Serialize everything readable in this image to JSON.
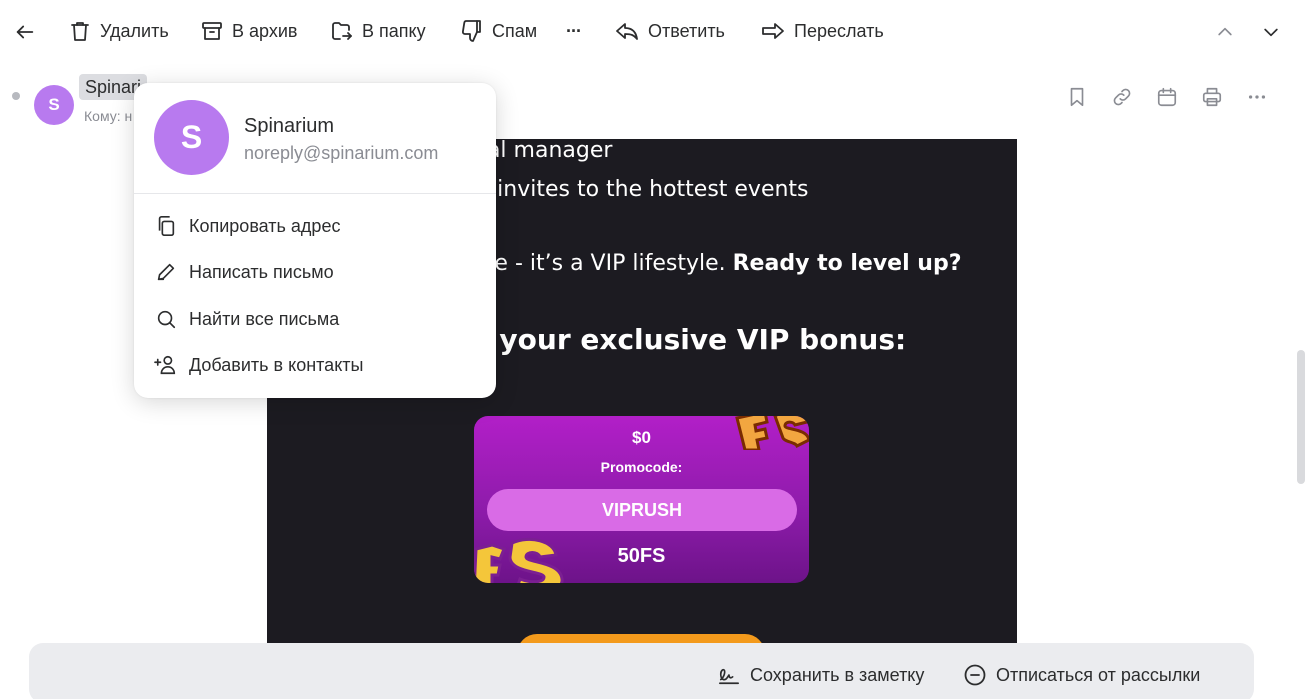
{
  "toolbar": {
    "back_icon": "arrow-left-icon",
    "delete_label": "Удалить",
    "archive_label": "В архив",
    "folder_label": "В папку",
    "spam_label": "Спам",
    "more_label": "···",
    "reply_label": "Ответить",
    "forward_label": "Переслать",
    "prev_icon": "chevron-up-icon",
    "next_icon": "chevron-down-icon"
  },
  "message": {
    "sender_chip": "Spinari",
    "avatar_letter": "S",
    "to_prefix": "Кому: н"
  },
  "header_icons": [
    "bookmark-icon",
    "link-icon",
    "calendar-icon",
    "print-icon",
    "more-icon"
  ],
  "email_body": {
    "line1": "nal manager",
    "line2": "& invites to the hottest events",
    "line3_plain": "me - it’s a VIP lifestyle. ",
    "line3_bold": "Ready to level up?",
    "heading": "s your exclusive VIP bonus:",
    "promo": {
      "amount": "$0",
      "label": "Promocode:",
      "code": "VIPRUSH",
      "freespins": "50FS"
    }
  },
  "popup": {
    "avatar_letter": "S",
    "name": "Spinarium",
    "email": "noreply@spinarium.com",
    "items": [
      {
        "label": "Копировать адрес",
        "icon": "copy-icon"
      },
      {
        "label": "Написать письмо",
        "icon": "pencil-icon"
      },
      {
        "label": "Найти все письма",
        "icon": "search-icon"
      },
      {
        "label": "Добавить в контакты",
        "icon": "add-contact-icon"
      }
    ]
  },
  "bottom_bar": {
    "save_note_label": "Сохранить в заметку",
    "unsubscribe_label": "Отписаться от рассылки"
  },
  "colors": {
    "avatar": "#b87aef",
    "email_bg": "#1c1b21",
    "promo_bg": "#b21fc8",
    "promo_button": "#d96be6",
    "cta": "#f39a1c",
    "bottom_bar_bg": "#ebecef"
  }
}
